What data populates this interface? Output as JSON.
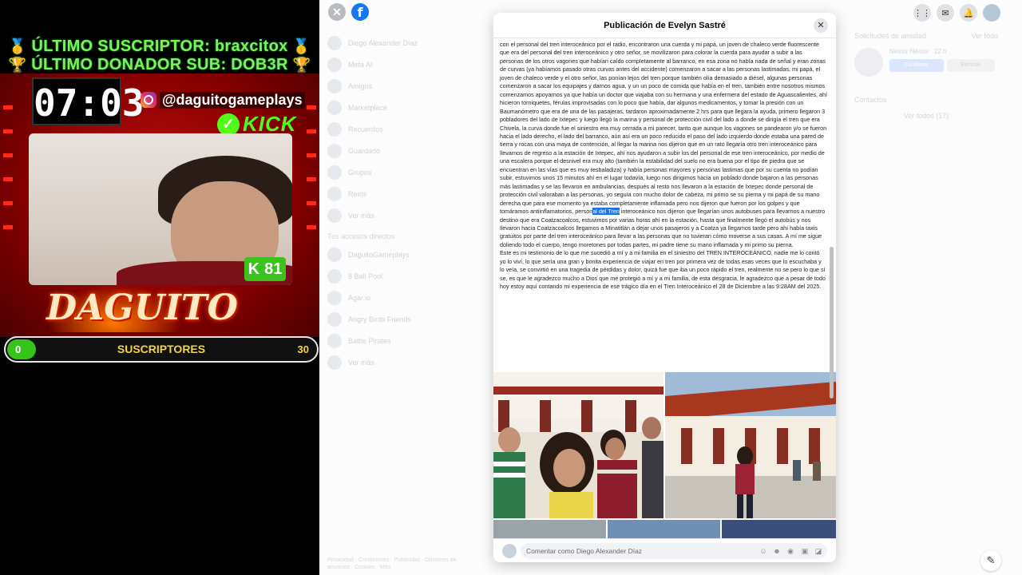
{
  "overlay": {
    "banner_last_sub": "ÚLTIMO SUSCRIPTOR: braxcitox",
    "banner_last_donor": "ÚLTIMO DONADOR SUB: DOB3R",
    "clock": "07:03",
    "instagram_handle": "@daguitogameplays",
    "kick_label": "KICK",
    "k_badge": "K",
    "k_badge_count": "81",
    "logo_text": "DAGUITO",
    "sub_goal_label": "SUSCRIPTORES",
    "sub_goal_current": "0",
    "sub_goal_target": "30",
    "sub_goal_progress": 0.03,
    "colors": {
      "green": "#7df05a",
      "kick": "#53fc18",
      "red": "#c01010",
      "gold": "#f5d23c"
    }
  },
  "facebook": {
    "left_nav": [
      "Diego Alexander Díaz",
      "Meta AI",
      "Amigos",
      "Marketplace",
      "Recuerdos",
      "Guardado",
      "Grupos",
      "Reels",
      "Ver más"
    ],
    "shortcuts_title": "Tus accesos directos",
    "shortcuts": [
      "DaguitoGameplays",
      "8 Ball Pool",
      "Agar.io",
      "Angry Birds Friends",
      "Battle Pirates",
      "Ver más"
    ],
    "footer": "Privacidad · Condiciones · Publicidad · Opciones de anuncios · Cookies · Más",
    "requests_title": "Solicitudes de amistad",
    "requests_see_all": "Ver todo",
    "request_name": "Néstor Néstor",
    "request_time": "22 h",
    "confirm_label": "Confirmar",
    "delete_label": "Eliminar",
    "contacts_title": "Contactos",
    "see_all_contacts": "Ver todos (17)"
  },
  "modal": {
    "title": "Publicación de Evelyn Sastré",
    "close_icon": "close-icon",
    "text_before_highlight": "con el personal del tren interoceánico por el radio, encontraron una cuerda y mi papá, un joven de chaleco verde fluorescente que era del personal del tren interoceánico y otro señor, se movilizaron para colorar la cuerda para ayudar a subir a las personas de los otros vagones que habían caído completamente al barranco, en esa zona no había nada de señal y eran zonas de curvas (ya habíamos pasado otras curvas antes del accidente) comenzaron a sacar a las personas lastimadas, mi papá, el joven de chaleco verde y el otro señor, las ponían lejos del tren porque también olía demasiado a diésel, algunas personas comenzaron a sacar los equipajes y darnos agua, y un un poco de comida que había en el tren, también entre nosotros mismos comenzamos apoyarnos ya que había un doctor que viajaba con su hermana y una enfermera del estado de Aguascalientes, ahí hicieron torniquetes, férulas improvisadas con lo poco que había, dar algunos medicamentos, y tomar la presión con un Baumanómetro que era de una de las pasajeras, tardaron aproximadamente 2 hrs para que llegara la ayuda, primero llegaron 3 pobladores del lado de Ixtepec y luego llegó la marina y personal de protección civil del lado a donde se dirigía el tren que era Chivela, la curva donde fue el siniestro era muy cerrada a mi parecer, tanto que aunque los vagones se pandearon y/o se fueron hacia el lado derecho, el lado del barranco, aún así era un poco reducido el paso del lado izquierdo donde estaba una pared de tierra y rocas con una maya de contención, al llegar la marina nos dijeron que en un rato llegaría otro tren interoceánico para llevarnos de regreso a la estación de Ixtepec, ahí nos ayudaron a subir los del personal de ese tren interoceánico, por medio de una escalera porque el desnivel era muy alto (también la estabilidad del suelo no era buena por el tipo de piedra que se encuentran en las vías que es muy resbaladiza) y había personas mayores y personas lastimas que por su cuenta no podían subir, estuvimos unos 15 minutos ahí en el lugar todavía, luego nos dirigimos hacia un poblado donde bajaron a las personas más lastimadas y se las llevaron en ambulancias, después al resto nos llevaron a la estación de Ixtepec donde personal de protección civil valoraban a las personas, yo seguía con mucho dolor de cabeza, mi primo se su pierna y mi papá de su mano derecha que para ese momento ya estaba completamente inflamada pero nos dijeron que fueron por los golpes y que tomáramos antiinflamatorios, person",
    "highlight": "al del Tren",
    "text_after_highlight": " interoceánico nos dijeron que llegarían unos autobuses para llevarnos a nuestro destino que era Coatzacoalcos, estuvimos por varias horas ahí en la estación, hasta que finalmente llegó el autobús y nos llevaron hacia Coatzacoalcos llegamos a Minatitlán a dejar unos pasajeros y a Coatza ya llegamos tarde pero ahí había taxis gratuitos por parte del tren interoceánico para llevar a las personas que no tuvieran cómo moverse a sus casas. A mí me sigue doliendo todo el cuerpo, tengo moretones por todas partes, mi padre tiene su mano inflamada y mi primo su pierna.",
    "paragraph2": "Este es mi testimonio de lo que me sucedió a mí y a mi familia en el siniestro del TREN INTEROCEÁNICO, nadie me lo contó yo lo viví, lo que sería una gran y bonita experiencia de viajar en tren por primera vez de todas esas veces que lo escuchaba y lo veía, se convirtió en una tragedia de pérdidas y dolor, quizá fue que iba un poco rápido el tren, realmente no se pero lo que sí se, es que le agradezco mucho a Dios que me protegió a mí y a mi familia, de esta desgracia, le agradezco que a pesar de todo hoy estoy aquí contando mi experiencia de ese trágico día en el Tren Interoceánico el 28 de Diciembre a las 9:28AM del 2025.",
    "comment_placeholder": "Comentar como Diego Alexander Díaz"
  }
}
